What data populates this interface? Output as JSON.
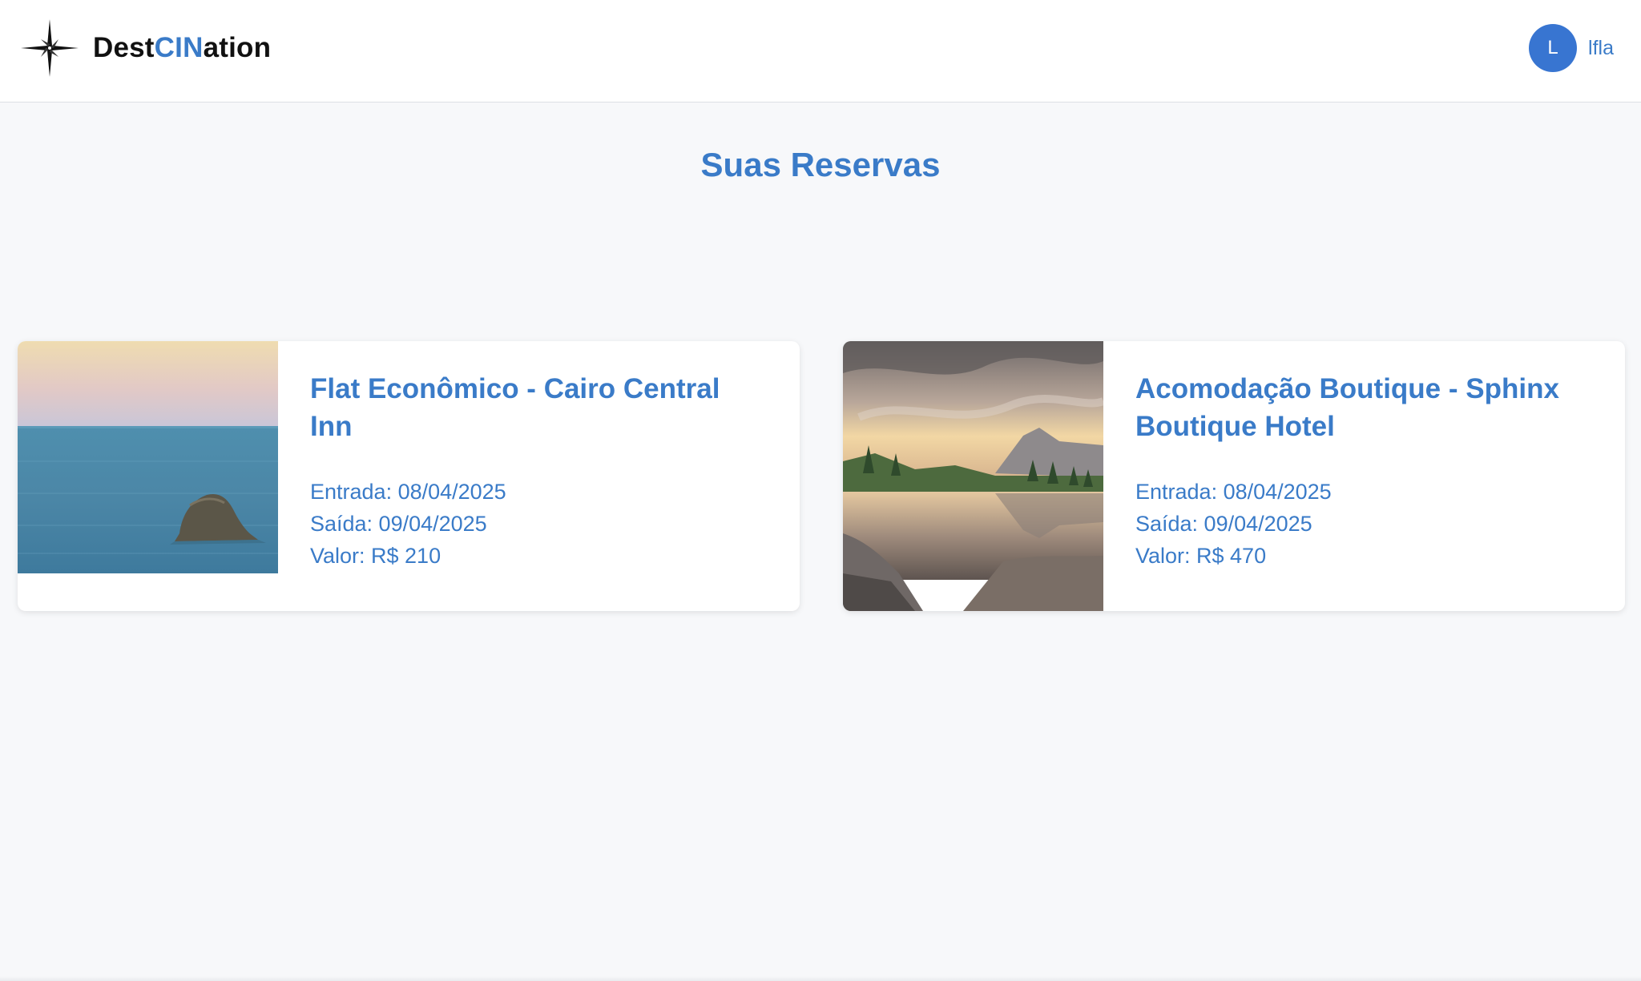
{
  "header": {
    "brand": {
      "prefix": "Dest",
      "accent": "CIN",
      "suffix": "ation"
    },
    "user": {
      "initial": "L",
      "name": "lfla"
    }
  },
  "main": {
    "title": "Suas Reservas",
    "reservations": [
      {
        "name": "Flat Econômico - Cairo Central Inn",
        "checkin": "Entrada: 08/04/2025",
        "checkout": "Saída: 09/04/2025",
        "price": "Valor: R$ 210",
        "image": "sea-rock-photo"
      },
      {
        "name": "Acomodação Boutique - Sphinx Boutique Hotel",
        "checkin": "Entrada: 08/04/2025",
        "checkout": "Saída: 09/04/2025",
        "price": "Valor: R$ 470",
        "image": "mountain-lake-photo"
      }
    ]
  },
  "colors": {
    "accent": "#3a7bc8",
    "avatar": "#3875d1",
    "background": "#f7f8fa"
  }
}
